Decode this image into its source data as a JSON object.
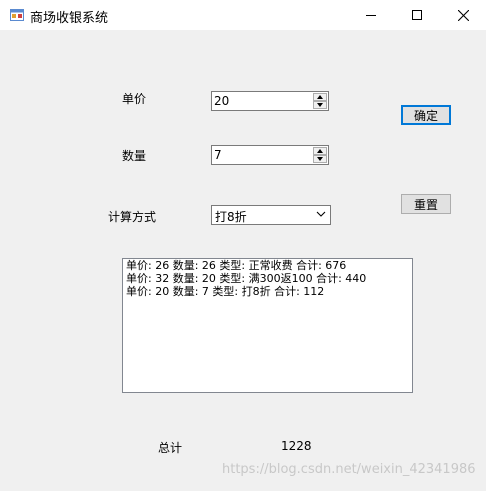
{
  "window": {
    "title": "商场收银系统",
    "accent": "#0078d7"
  },
  "form": {
    "price_label": "单价",
    "price_value": "20",
    "quantity_label": "数量",
    "quantity_value": "7",
    "method_label": "计算方式",
    "method_selected": "打8折",
    "confirm_label": "确定",
    "reset_label": "重置"
  },
  "records": [
    "单价: 26 数量: 26 类型: 正常收费 合计: 676",
    "单价: 32 数量: 20 类型: 满300返100 合计: 440",
    "单价: 20 数量: 7 类型: 打8折 合计: 112"
  ],
  "summary": {
    "total_label": "总计",
    "total_value": "1228"
  },
  "watermark": "https://blog.csdn.net/weixin_42341986",
  "icons": {
    "app": "app-window-icon",
    "minimize": "minimize-icon",
    "maximize": "maximize-icon",
    "close": "close-icon",
    "spin_up": "spin-up-icon",
    "spin_down": "spin-down-icon",
    "dropdown": "chevron-down-icon"
  }
}
